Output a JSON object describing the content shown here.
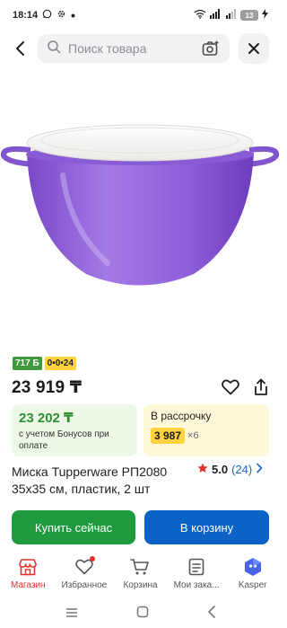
{
  "status_bar": {
    "time": "18:14",
    "battery": "13"
  },
  "search": {
    "placeholder": "Поиск товара"
  },
  "product": {
    "badges": {
      "cashback": "717 Б",
      "installment": "0•0•24"
    },
    "price": "23 919 ₸",
    "bonus_offer": {
      "price": "23 202 ₸",
      "note": "с учетом Бонусов при оплате"
    },
    "installment_offer": {
      "title": "В рассрочку",
      "amount": "3 987",
      "times": "×6"
    },
    "title": "Миска Tupperware РП2080 35х35 см, пластик, 2 шт",
    "rating": {
      "value": "5.0",
      "count": "(24)"
    },
    "colors": {
      "bowl": "#8f5fd6",
      "lid": "#f7f7f5"
    }
  },
  "actions": {
    "buy_now": "Купить сейчас",
    "add_to_cart": "В корзину"
  },
  "bottom_nav": {
    "items": [
      {
        "label": "Магазин",
        "icon": "store-icon",
        "active": true
      },
      {
        "label": "Избранное",
        "icon": "heart-icon",
        "active": false
      },
      {
        "label": "Корзина",
        "icon": "cart-icon",
        "active": false
      },
      {
        "label": "Мои зака...",
        "icon": "orders-icon",
        "active": false
      },
      {
        "label": "Kasper",
        "icon": "kasper-icon",
        "active": false
      }
    ]
  },
  "theme": {
    "accent_green": "#1e9b3e",
    "accent_blue": "#0b63c5",
    "active_red": "#e3312d"
  }
}
